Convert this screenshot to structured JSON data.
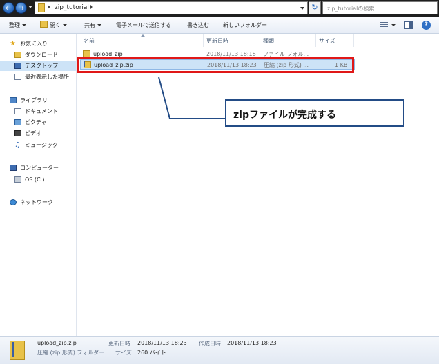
{
  "address": {
    "path_segment": "zip_tutorial",
    "search_placeholder": "zip_tutorialの検索"
  },
  "toolbar": {
    "organize": "整理",
    "open": "開く",
    "share": "共有",
    "email": "電子メールで送信する",
    "burn": "書き込む",
    "new_folder": "新しいフォルダー"
  },
  "nav": {
    "favorites": "お気に入り",
    "downloads": "ダウンロード",
    "desktop": "デスクトップ",
    "recent": "最近表示した場所",
    "libraries": "ライブラリ",
    "documents": "ドキュメント",
    "pictures": "ピクチャ",
    "videos": "ビデオ",
    "music": "ミュージック",
    "computer": "コンピューター",
    "drive_c": "OS (C:)",
    "network": "ネットワーク"
  },
  "columns": {
    "name": "名前",
    "date": "更新日時",
    "type": "種類",
    "size": "サイズ"
  },
  "files": [
    {
      "name": "upload_zip",
      "date": "2018/11/13 18:18",
      "type": "ファイル フォル...",
      "size": ""
    },
    {
      "name": "upload_zip.zip",
      "date": "2018/11/13 18:23",
      "type": "圧縮 (zip 形式) ...",
      "size": "1 KB"
    }
  ],
  "callout": {
    "text": "zipファイルが完成する"
  },
  "details": {
    "filename": "upload_zip.zip",
    "type": "圧縮 (zip 形式) フォルダー",
    "modified_label": "更新日時:",
    "modified_value": "2018/11/13 18:23",
    "created_label": "作成日時:",
    "created_value": "2018/11/13 18:23",
    "size_label": "サイズ:",
    "size_value": "260 バイト"
  },
  "colors": {
    "highlight_red": "#e01818",
    "callout_border": "#234c86",
    "selection": "#cde3f7"
  }
}
